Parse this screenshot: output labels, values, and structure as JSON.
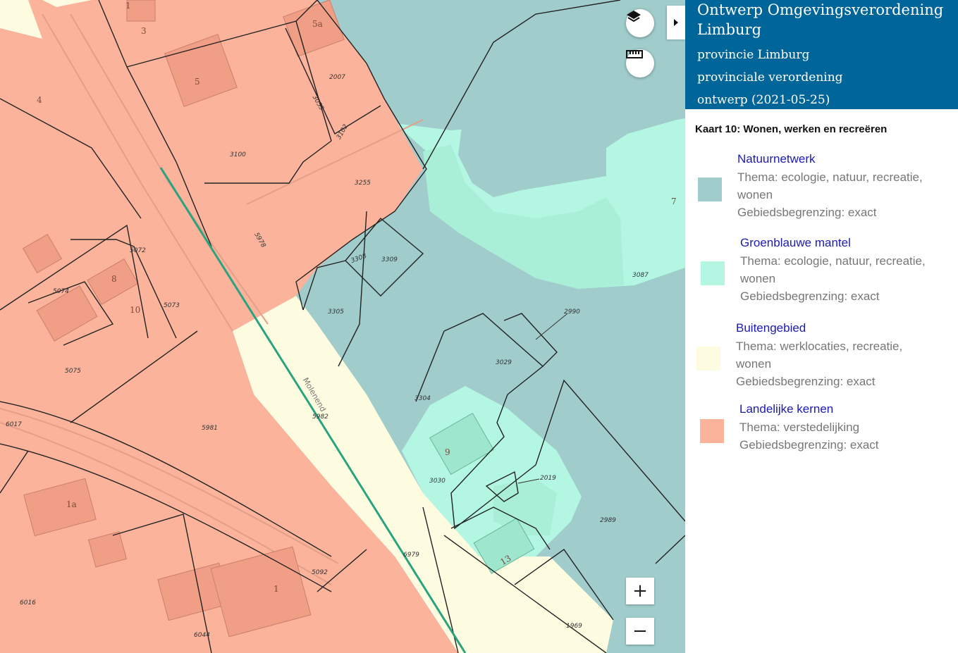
{
  "panel": {
    "title": "Ontwerp Omgevingsverordening Limburg",
    "organisation": "provincie Limburg",
    "doc_type": "provinciale verordening",
    "status": "ontwerp (2021-05-25)",
    "map_name": "Kaart 10: Wonen, werken en recreëren"
  },
  "legend": [
    {
      "name": "Natuurnetwerk",
      "line1": "Thema: ecologie, natuur, recreatie,",
      "line2": "wonen",
      "line3": "Gebiedsbegrenzing: exact",
      "color": "#a0cccb"
    },
    {
      "name": "Groenblauwe mantel",
      "line1": "Thema: ecologie, natuur, recreatie,",
      "line2": "wonen",
      "line3": "Gebiedsbegrenzing: exact",
      "color": "#b3f7e3"
    },
    {
      "name": "Buitengebied",
      "line1": "Thema: werklocaties, recreatie,",
      "line2": "wonen",
      "line3": "Gebiedsbegrenzing: exact",
      "color": "#fdfbe0"
    },
    {
      "name": "Landelijke kernen",
      "line1": "Thema: verstedelijking",
      "line2": "Gebiedsbegrenzing: exact",
      "color": "#fbb39b"
    }
  ],
  "controls": {
    "layers_icon": "layers-icon",
    "measure_icon": "ruler-icon",
    "panel_toggle_icon": "caret-right-icon",
    "zoom_in": "+",
    "zoom_out": "−"
  },
  "map": {
    "parcels": [
      "1",
      "3",
      "5a",
      "2007",
      "3053",
      "3102",
      "5",
      "4",
      "3100",
      "3255",
      "5978",
      "5072",
      "5074",
      "8",
      "10",
      "5073",
      "5075",
      "3308",
      "3309",
      "3305",
      "2990",
      "3029",
      "3304",
      "5982",
      "6017",
      "5981",
      "9",
      "3030",
      "2019",
      "1a",
      "2989",
      "3087",
      "7",
      "6979",
      "5092",
      "13",
      "1",
      "6016",
      "6044",
      "1969"
    ],
    "street": "Molenend"
  }
}
